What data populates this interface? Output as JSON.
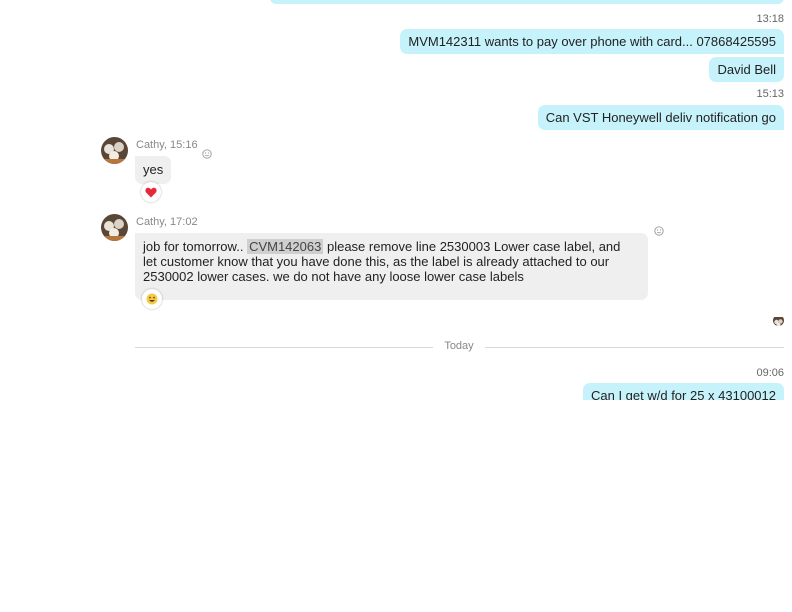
{
  "messages": [
    {
      "time": "13:18"
    },
    {
      "text": "MVM142311 wants to pay over phone with card... 07868425595"
    },
    {
      "text": "David Bell"
    },
    {
      "time": "15:13"
    },
    {
      "text": "Can VST Honeywell deliv notification  go"
    },
    {
      "sender": "Cathy, 15:16",
      "text": "yes",
      "reaction": "heart"
    },
    {
      "sender": "Cathy, 17:02",
      "line1_pre": "job for tomorrow..",
      "line1_highlight": "CVM142063",
      "line1_post": "please remove line 2530003 Lower case label, and",
      "line2": "let customer know that you have done this, as the label is already attached to our",
      "line3": "2530002 lower cases.  we do not have any loose lower case labels",
      "reaction": "grin"
    },
    {
      "divider": "Today"
    },
    {
      "time": "09:06"
    },
    {
      "text": "Can I get w/d for 25 x 43100012"
    }
  ],
  "colors": {
    "outgoing": "#c6f2fb",
    "incoming": "#efefef",
    "heart": "#e5283a"
  }
}
